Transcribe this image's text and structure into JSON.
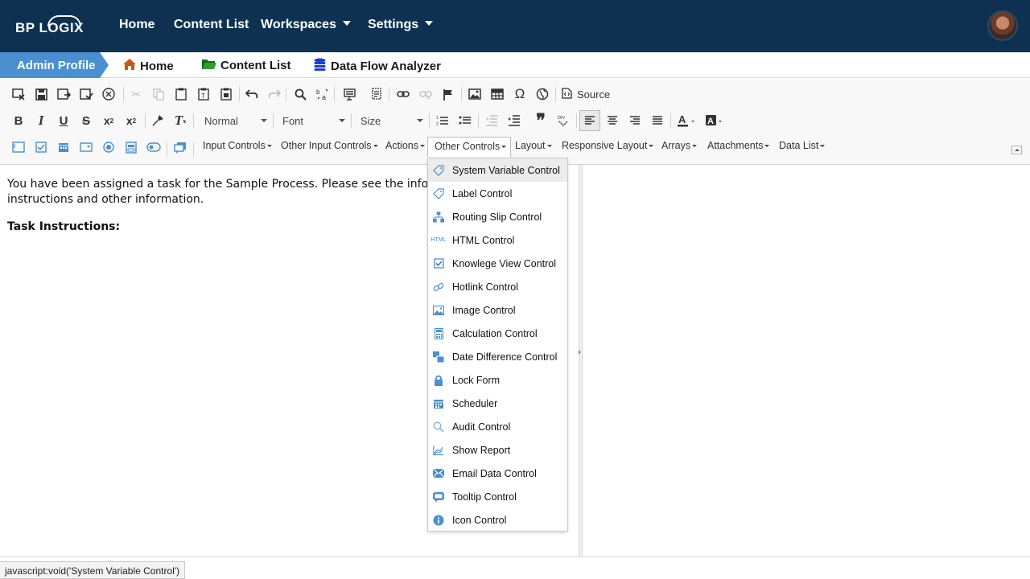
{
  "brand": {
    "logo_text": "BP LOGIX"
  },
  "nav": {
    "items": [
      {
        "label": "Home",
        "has_caret": false
      },
      {
        "label": "Content List",
        "has_caret": false
      },
      {
        "label": "Workspaces",
        "has_caret": true
      },
      {
        "label": "Settings",
        "has_caret": true
      }
    ]
  },
  "breadcrumb": {
    "active": "Admin Profile",
    "links": [
      "Home",
      "Content List",
      "Data Flow Analyzer"
    ]
  },
  "toolbar": {
    "source_label": "Source",
    "format_combo": "Normal",
    "font_combo": "Font",
    "size_combo": "Size",
    "menus": [
      "Input Controls",
      "Other Input Controls",
      "Actions",
      "Other Controls",
      "Layout",
      "Responsive Layout",
      "Arrays",
      "Attachments",
      "Data List"
    ],
    "open_menu": "Other Controls"
  },
  "content": {
    "line1": "You have been assigned a task for the Sample Process. Please see the informa",
    "line2": "instructions and other information.",
    "heading": "Task Instructions:"
  },
  "dropdown": {
    "items": [
      {
        "label": "System Variable Control",
        "icon": "tag-icon"
      },
      {
        "label": "Label Control",
        "icon": "tag-icon"
      },
      {
        "label": "Routing Slip Control",
        "icon": "hierarchy-icon"
      },
      {
        "label": "HTML Control",
        "icon": "html-icon"
      },
      {
        "label": "Knowlege View Control",
        "icon": "checkbox-icon"
      },
      {
        "label": "Hotlink Control",
        "icon": "link-icon"
      },
      {
        "label": "Image Control",
        "icon": "image-icon"
      },
      {
        "label": "Calculation Control",
        "icon": "calculator-icon"
      },
      {
        "label": "Date Difference Control",
        "icon": "date-diff-icon"
      },
      {
        "label": "Lock Form",
        "icon": "lock-icon"
      },
      {
        "label": "Scheduler",
        "icon": "calendar-icon"
      },
      {
        "label": "Audit Control",
        "icon": "magnifier-icon"
      },
      {
        "label": "Show Report",
        "icon": "chart-icon"
      },
      {
        "label": "Email Data Control",
        "icon": "envelope-icon"
      },
      {
        "label": "Tooltip Control",
        "icon": "speech-bubble-icon"
      },
      {
        "label": "Icon Control",
        "icon": "info-icon"
      }
    ],
    "hovered_index": 0
  },
  "status": {
    "text": "javascript:void('System Variable Control')"
  },
  "colors": {
    "nav_bg": "#0e3152",
    "crumb_active": "#4a8fd0",
    "icon_blue": "#4a8fd0",
    "home_icon": "#c85a10",
    "folder_icon": "#1f8b1f",
    "db_icon": "#1d3fcf"
  }
}
